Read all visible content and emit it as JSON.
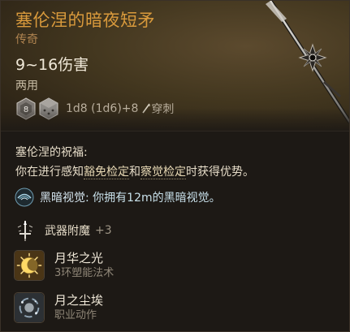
{
  "item": {
    "title": "塞伦涅的暗夜短矛",
    "rarity": "传奇",
    "damage_range": "9~16伤害",
    "handedness": "两用",
    "dice": {
      "die_value": "8",
      "formula": "1d8 (1d6)+8",
      "damage_type": "穿刺",
      "damage_type_icon": "piercing-icon"
    }
  },
  "blessing": {
    "title": "塞伦涅的祝福:",
    "desc_prefix": "你在进行感知",
    "desc_link1": "豁免检定",
    "desc_mid": "和",
    "desc_link2": "察觉检定",
    "desc_suffix": "时获得优势。"
  },
  "darkvision": {
    "name": "黑暗视觉",
    "desc": ": 你拥有12m的黑暗视觉。",
    "icon": "darkvision-eye-icon"
  },
  "enchantment": {
    "label": "武器附魔",
    "bonus": "+3",
    "icon": "enchant-sword-icon"
  },
  "spells": [
    {
      "name": "月华之光",
      "sub": "3环塑能法术",
      "icon": "moonbeam-icon"
    },
    {
      "name": "月之尘埃",
      "sub": "职业动作",
      "icon": "lunar-dust-icon"
    }
  ],
  "colors": {
    "title": "#d99a3c",
    "rarity": "#b08450",
    "darkvision": "#c8e0ea"
  }
}
